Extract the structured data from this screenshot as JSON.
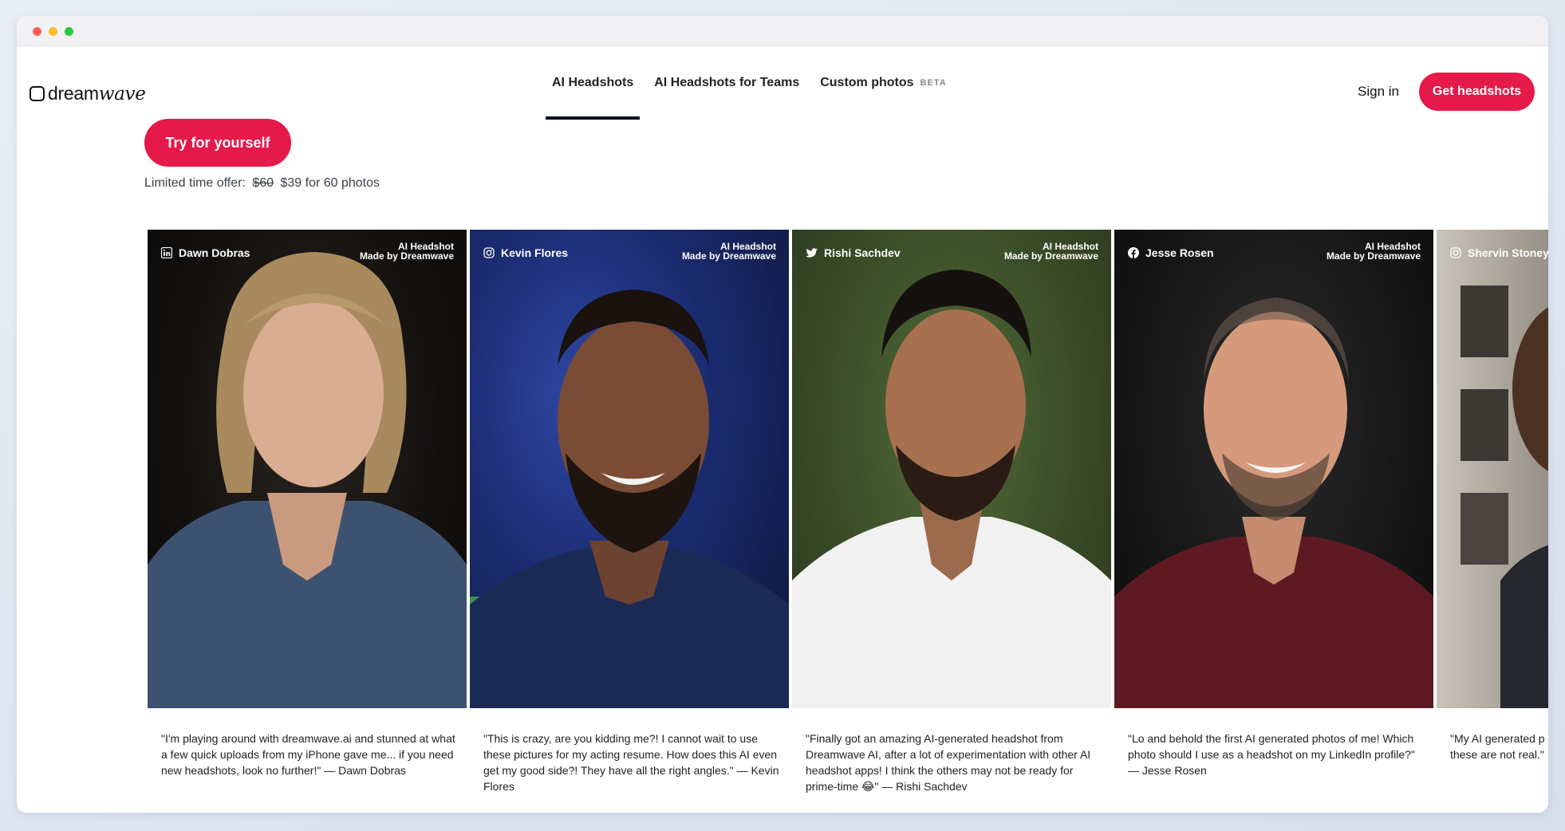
{
  "brand": {
    "name_part1": "dream",
    "name_part2": "wave"
  },
  "nav": {
    "links": [
      {
        "label": "AI Headshots",
        "active": true
      },
      {
        "label": "AI Headshots for Teams",
        "active": false
      },
      {
        "label": "Custom photos",
        "badge": "BETA",
        "active": false
      }
    ],
    "sign_in": "Sign in",
    "cta": "Get headshots"
  },
  "hero": {
    "cta": "Try for yourself",
    "offer_prefix": "Limited time offer:",
    "old_price": "$60",
    "new_price": "$39 for 60 photos"
  },
  "colors": {
    "accent": "#e5194a",
    "nav_underline": "#0b0f1f"
  },
  "testimonials": [
    {
      "name": "Dawn Dobras",
      "source_icon": "linkedin-icon",
      "tag_line1": "AI Headshot",
      "tag_line2": "Made by Dreamwave",
      "quote": "\"I'm playing around with dreamwave.ai and stunned at what a few quick uploads from my iPhone gave me... if you need new headshots, look no further!\" — Dawn Dobras"
    },
    {
      "name": "Kevin Flores",
      "source_icon": "instagram-icon",
      "tag_line1": "AI Headshot",
      "tag_line2": "Made by Dreamwave",
      "quote": "\"This is crazy, are you kidding me?! I cannot wait to use these pictures for my acting resume. How does this AI even get my good side?! They have all the right angles.\" — Kevin Flores"
    },
    {
      "name": "Rishi Sachdev",
      "source_icon": "twitter-icon",
      "tag_line1": "AI Headshot",
      "tag_line2": "Made by Dreamwave",
      "quote": "\"Finally got an amazing AI-generated headshot from Dreamwave AI, after a lot of experimentation with other AI headshot apps! I think the others may not be ready for prime-time 😂\" — Rishi Sachdev"
    },
    {
      "name": "Jesse Rosen",
      "source_icon": "facebook-icon",
      "tag_line1": "AI Headshot",
      "tag_line2": "Made by Dreamwave",
      "quote": "\"Lo and behold the first AI generated photos of me! Which photo should I use as a headshot on my LinkedIn profile?\" — Jesse Rosen"
    },
    {
      "name": "Shervin Stoney",
      "source_icon": "instagram-icon",
      "quote": "\"My AI generated p these are not real.\""
    }
  ]
}
